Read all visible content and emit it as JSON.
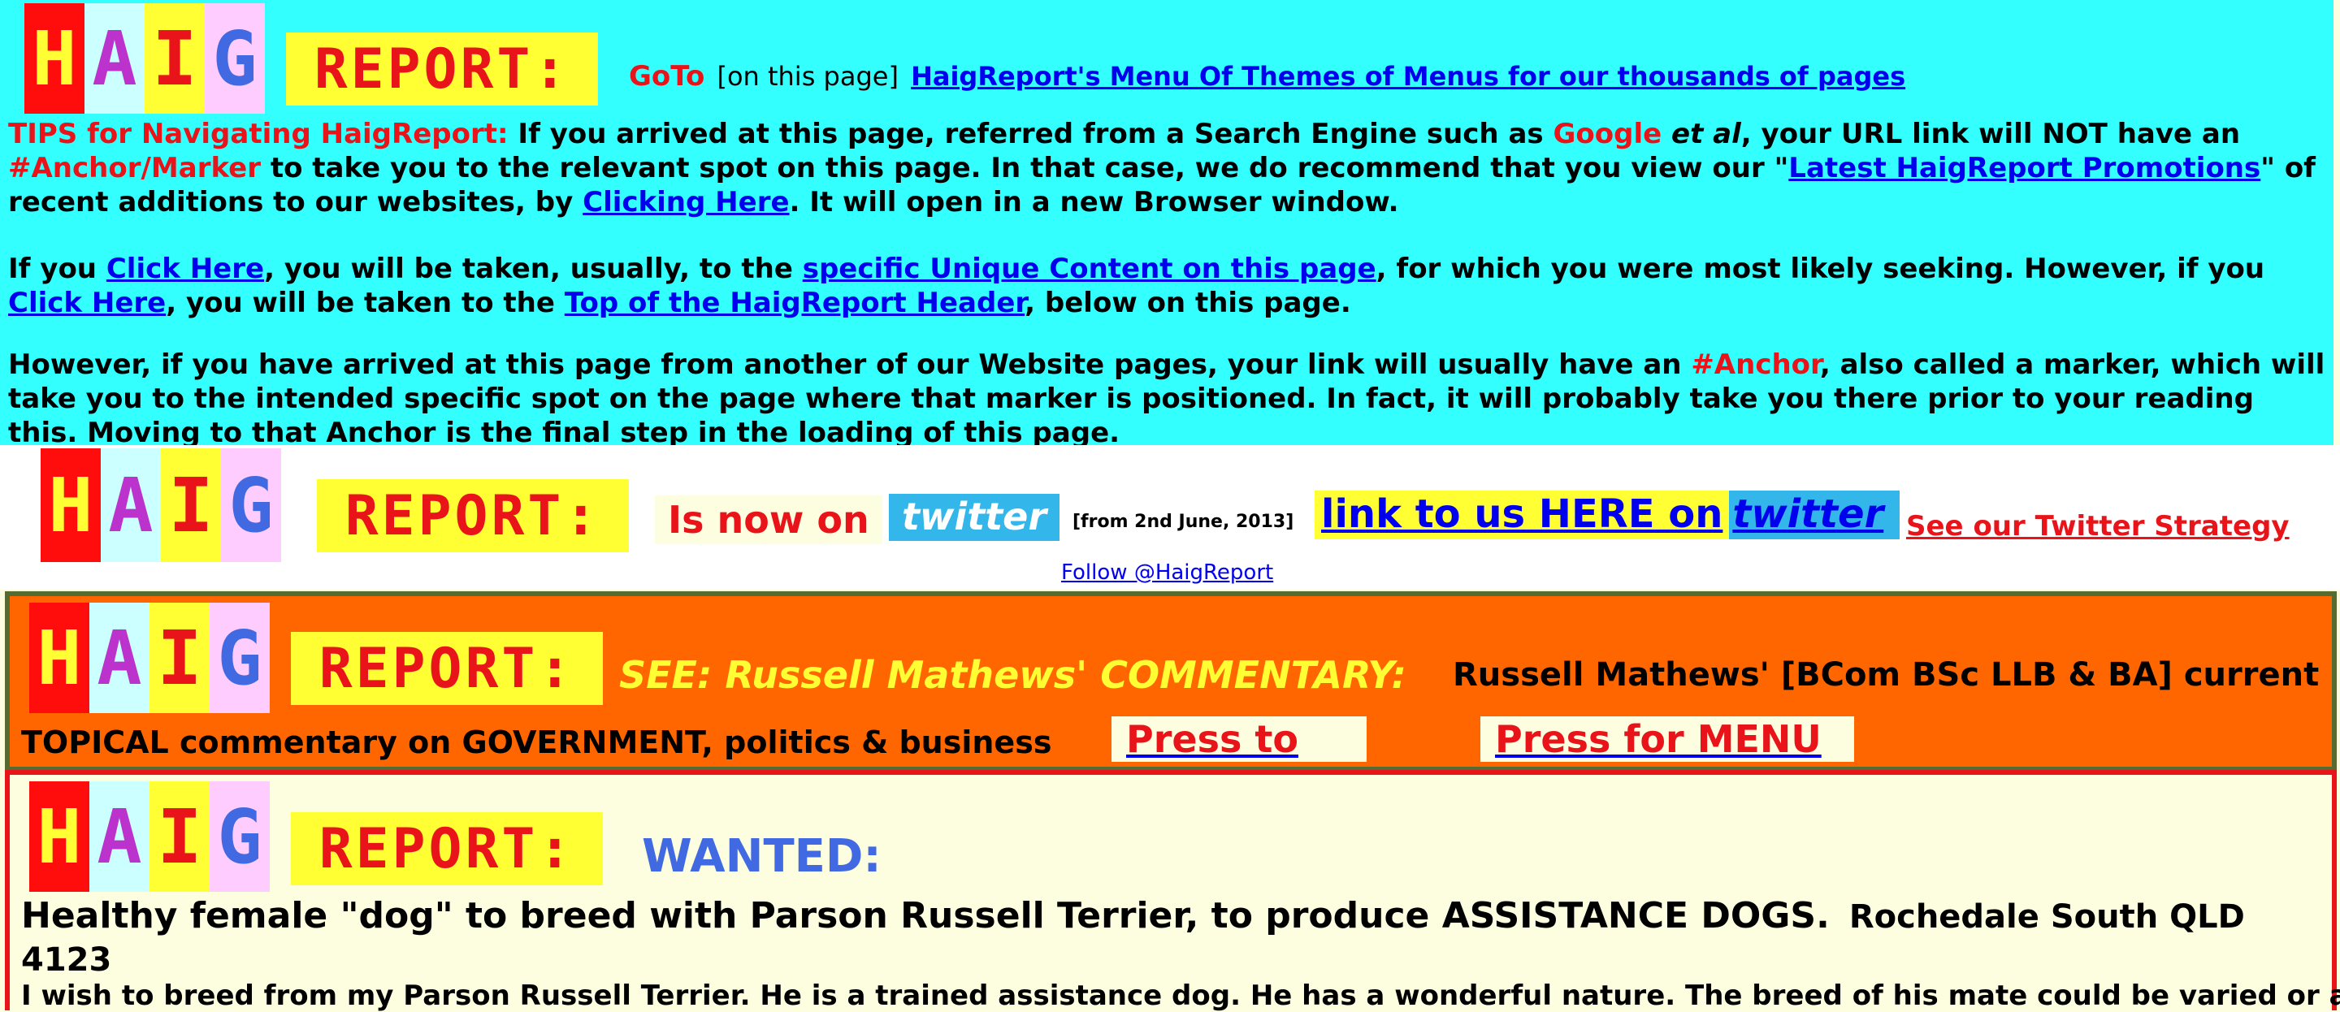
{
  "logo": {
    "h": "H",
    "a": "A",
    "i": "I",
    "g": "G",
    "report": "REPORT:"
  },
  "tips": {
    "goto": "GoTo",
    "on_page": "[on this page]",
    "menu_link": "HaigReport's Menu Of Themes of Menus for our thousands of pages",
    "p1_label": "TIPS for Navigating HaigReport:",
    "p1_a": " If you arrived at this page, referred from a Search Engine such as ",
    "google": "Google",
    "et_al": " et al",
    "p1_b": ", your URL link will NOT have an ",
    "anchor_marker": "#Anchor/Marker",
    "p1_c": " to take you to the relevant spot on this page.  In that case, we do recommend that you view our \"",
    "latest_link": "Latest HaigReport Promotions",
    "p1_d": "\" of recent additions to our websites, by ",
    "clicking_here": "Clicking Here",
    "p1_e": ".  It will open in a new Browser window.",
    "p2_a": "If you ",
    "click_here_1": "Click Here",
    "p2_b": ", you will be taken, usually, to the ",
    "unique_link": "specific Unique Content on this page",
    "p2_c": ", for which you were most likely seeking.  However, if you ",
    "click_here_2": "Click Here",
    "p2_d": ", you will be taken to the ",
    "top_link": "Top of the HaigReport Header",
    "p2_e": ", below on this page.",
    "p3_a": "However, if you have arrived at this page from another of our Website pages, your link will usually have an ",
    "anchor": "#Anchor",
    "p3_b": ", also called a marker, which will take you to the intended specific spot on the page where that marker is positioned.  In fact, it will probably take you there prior to your reading this.  Moving to that Anchor is the final step in the loading of this page."
  },
  "twitter": {
    "now_on": "Is now on",
    "twitter_word": "twitter",
    "from": "[from 2nd June, 2013]",
    "link_us": "link to us HERE on",
    "link_twitter": "twitter",
    "strategy": "See our Twitter Strategy",
    "follow": "Follow @HaigReport"
  },
  "commentary": {
    "see": "SEE: Russell Mathews' COMMENTARY:",
    "current": "Russell Mathews' [BCom BSc LLB & BA] current",
    "topical": "TOPICAL commentary on GOVERNMENT, politics & business",
    "read_btn": "Press to READ",
    "menu_btn": "Press for MENU"
  },
  "wanted": {
    "label": "WANTED:",
    "headline": "Healthy female \"dog\" to breed with Parson Russell Terrier, to produce ASSISTANCE DOGS.",
    "location": "Rochedale South QLD 4123",
    "body": "I wish to breed from my Parson Russell Terrier. He is a trained assistance dog. He has a wonderful nature. The breed of his mate could be varied or a cross;"
  },
  "colors": {
    "tips_bg": "#33ffff",
    "commentary_bg": "#ff6600",
    "wanted_border": "#e8141a",
    "twitter_blue": "#33b6ea",
    "haig_red": "#e8141a",
    "haig_yellow": "#ffff33"
  }
}
